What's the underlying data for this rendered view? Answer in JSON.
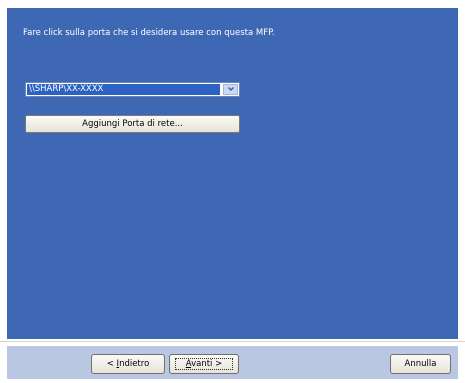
{
  "dialog": {
    "instruction": "Fare click sulla porta che si desidera usare con questa MFP.",
    "port_value": "\\\\SHARP\\XX-XXXX",
    "add_port_label": "Aggiungi Porta di rete..."
  },
  "footer": {
    "back": {
      "prefix": "< ",
      "mnemonic": "I",
      "rest": "ndietro"
    },
    "next": {
      "mnemonic": "A",
      "rest": "vanti >"
    },
    "cancel_label": "Annulla"
  },
  "icons": {
    "dropdown": "chevron-down-icon"
  },
  "colors": {
    "panel": "#3f68b4",
    "selection": "#2b62c4",
    "footer": "#b9c7e3"
  }
}
